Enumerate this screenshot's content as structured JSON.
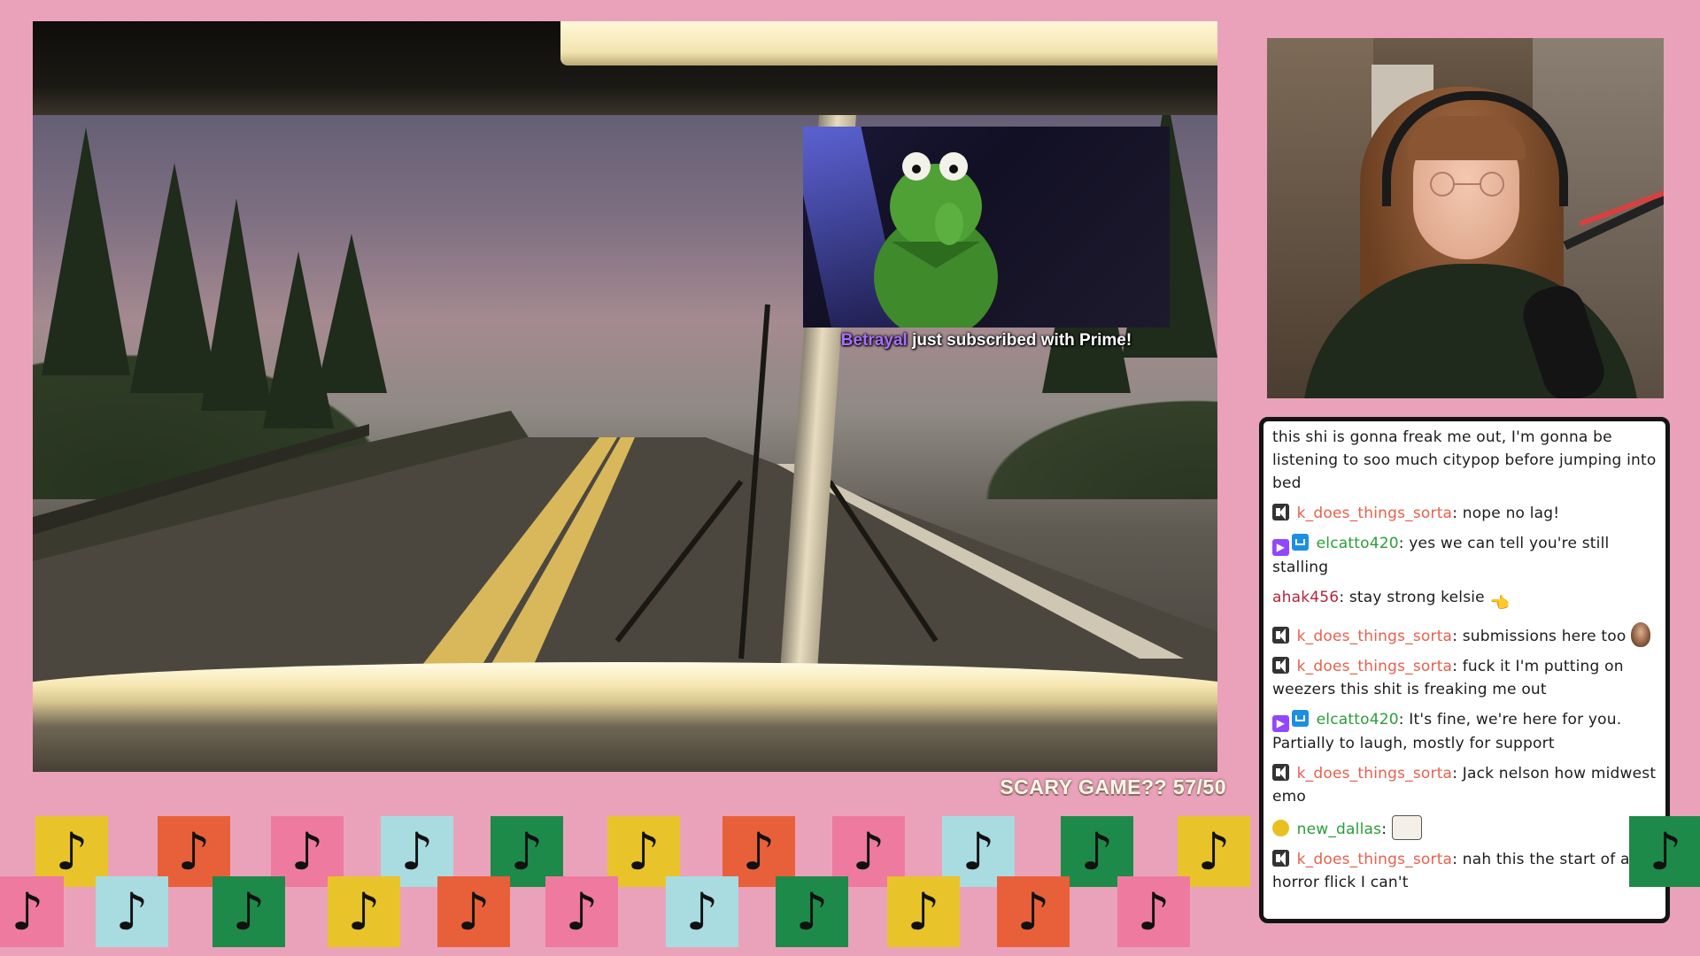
{
  "colors": {
    "background": "#eaa2ba",
    "tile_colors": [
      "#e8c42a",
      "#e8603a",
      "#ee7aa0",
      "#a8dce0",
      "#1d8a4a"
    ],
    "alert_username": "#a970ff",
    "mod_name": "#e8604c",
    "green_name": "#2a9d3a",
    "red_name": "#b3263e"
  },
  "alert": {
    "username": "Betrayal",
    "message": " just subscribed with Prime!"
  },
  "counter": {
    "label": "SCARY GAME?? 57/50"
  },
  "music_note_glyph": "♪",
  "chat": {
    "messages": [
      {
        "badges": [],
        "name": "",
        "sep": "",
        "text": "this shi is gonna freak me out, I'm gonna be listening to soo much citypop before jumping into bed"
      },
      {
        "badges": [
          "mod-icon"
        ],
        "name": "k_does_things_sorta",
        "sep": ": ",
        "text": "nope no lag!"
      },
      {
        "badges": [
          "prime-icon",
          "subscriber-icon"
        ],
        "name": "elcatto420",
        "sep": ": ",
        "text": "yes we can tell you're still stalling"
      },
      {
        "badges": [],
        "name": "ahak456",
        "sep": ": ",
        "text": "stay strong kelsie",
        "emote": "pointing-hand-emote"
      },
      {
        "badges": [
          "mod-icon"
        ],
        "name": "k_does_things_sorta",
        "sep": ": ",
        "text": "submissions here too",
        "emote": "face-emote"
      },
      {
        "badges": [
          "mod-icon"
        ],
        "name": "k_does_things_sorta",
        "sep": ": ",
        "text": "fuck it I'm putting on weezers this shit is freaking me out"
      },
      {
        "badges": [
          "prime-icon",
          "subscriber-icon"
        ],
        "name": "elcatto420",
        "sep": ": ",
        "text": "It's fine, we're here for you. Partially to laugh, mostly for support"
      },
      {
        "badges": [
          "mod-icon"
        ],
        "name": "k_does_things_sorta",
        "sep": ": ",
        "text": "Jack nelson how midwest emo"
      },
      {
        "badges": [
          "smiley-badge-icon"
        ],
        "name": "new_dallas",
        "sep": ": ",
        "text": "",
        "emote": "cat-emote"
      },
      {
        "badges": [
          "mod-icon"
        ],
        "name": "k_does_things_sorta",
        "sep": ": ",
        "text": "nah this the start of a horror flick I can't"
      }
    ]
  }
}
